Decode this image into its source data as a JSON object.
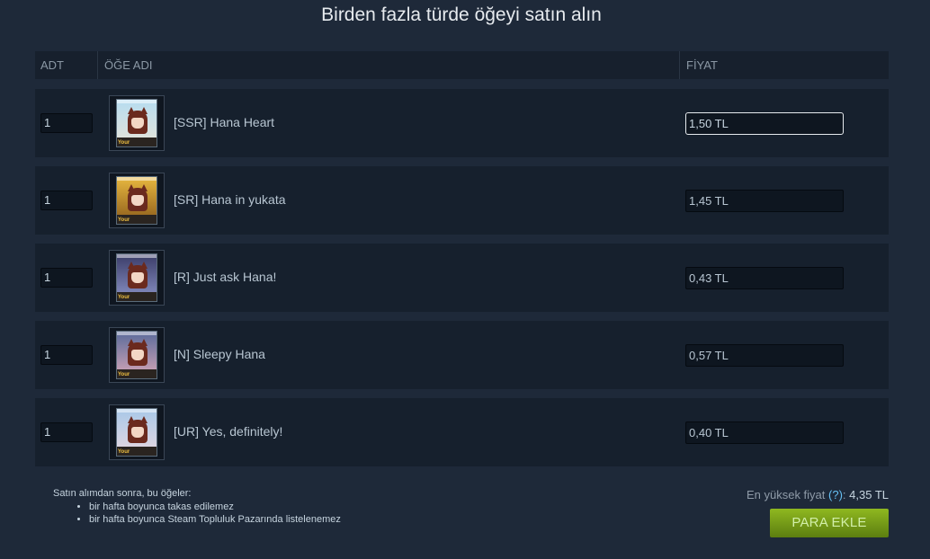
{
  "title": "Birden fazla türde öğeyi satın alın",
  "columns": {
    "qty": "ADT",
    "name": "ÖĞE ADI",
    "price": "FİYAT"
  },
  "items": [
    {
      "qty": "1",
      "name": "[SSR] Hana Heart",
      "price": "1,50 TL",
      "card_colors": [
        "#b6dcf0",
        "#e8e4d8"
      ]
    },
    {
      "qty": "1",
      "name": "[SR] Hana in yukata",
      "price": "1,45 TL",
      "card_colors": [
        "#e8b840",
        "#8a5a1a"
      ]
    },
    {
      "qty": "1",
      "name": "[R] Just ask Hana!",
      "price": "0,43 TL",
      "card_colors": [
        "#3a3c68",
        "#8c94c8"
      ]
    },
    {
      "qty": "1",
      "name": "[N] Sleepy Hana",
      "price": "0,57 TL",
      "card_colors": [
        "#5a6a9a",
        "#d8a8b8"
      ]
    },
    {
      "qty": "1",
      "name": "[UR] Yes, definitely!",
      "price": "0,40 TL",
      "card_colors": [
        "#a8c8e8",
        "#e8d8e0"
      ]
    }
  ],
  "card_badge": "Your",
  "notes": {
    "heading": "Satın alımdan sonra, bu öğeler:",
    "bullets": [
      "bir hafta boyunca takas edilemez",
      "bir hafta boyunca Steam Topluluk Pazarında listelenemez"
    ]
  },
  "max_price": {
    "label": "En yüksek fiyat ",
    "help": "(?)",
    "separator": ": ",
    "value": "4,35 TL"
  },
  "add_funds_button": "PARA EKLE"
}
